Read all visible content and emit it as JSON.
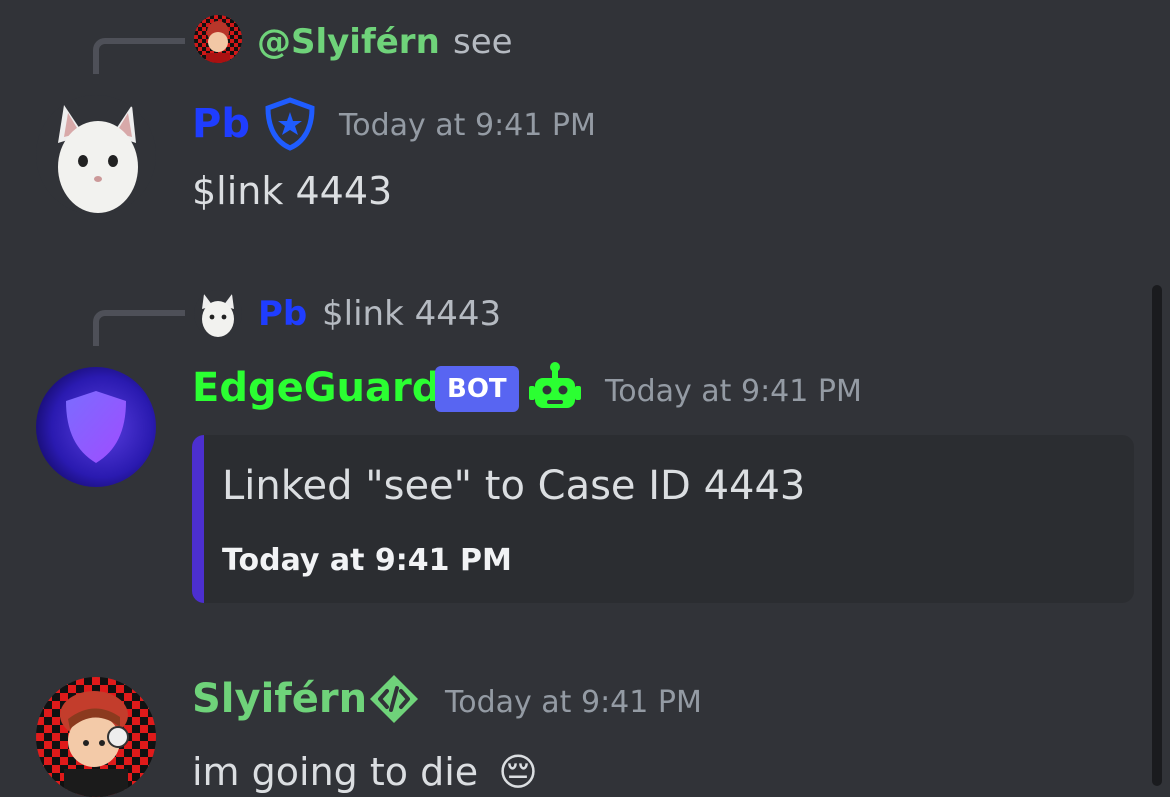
{
  "colors": {
    "background": "#313338",
    "pb_name": "#1f3dff",
    "edgeguard_name": "#2bff32",
    "slyifern_name": "#6fd37a",
    "bot_tag": "#5865f2",
    "embed_bar": "#4c2fd0"
  },
  "messages": [
    {
      "reply": {
        "mention": "@Slyiférn",
        "text": "see"
      },
      "author": "Pb",
      "badge_icon": "moderator-shield-icon",
      "timestamp": "Today at 9:41 PM",
      "content": "$link 4443"
    },
    {
      "reply": {
        "author": "Pb",
        "text": "$link 4443"
      },
      "author": "EdgeGuard",
      "tag": "BOT",
      "badge_icon": "robot-icon",
      "timestamp": "Today at 9:41 PM",
      "embed": {
        "description": "Linked \"see\" to Case ID 4443",
        "footer": "Today at 9:41 PM"
      }
    },
    {
      "author": "Slyiférn",
      "badge_icon": "developer-code-icon",
      "timestamp": "Today at 9:41 PM",
      "content": "im going to die",
      "emoji": "😔"
    }
  ]
}
